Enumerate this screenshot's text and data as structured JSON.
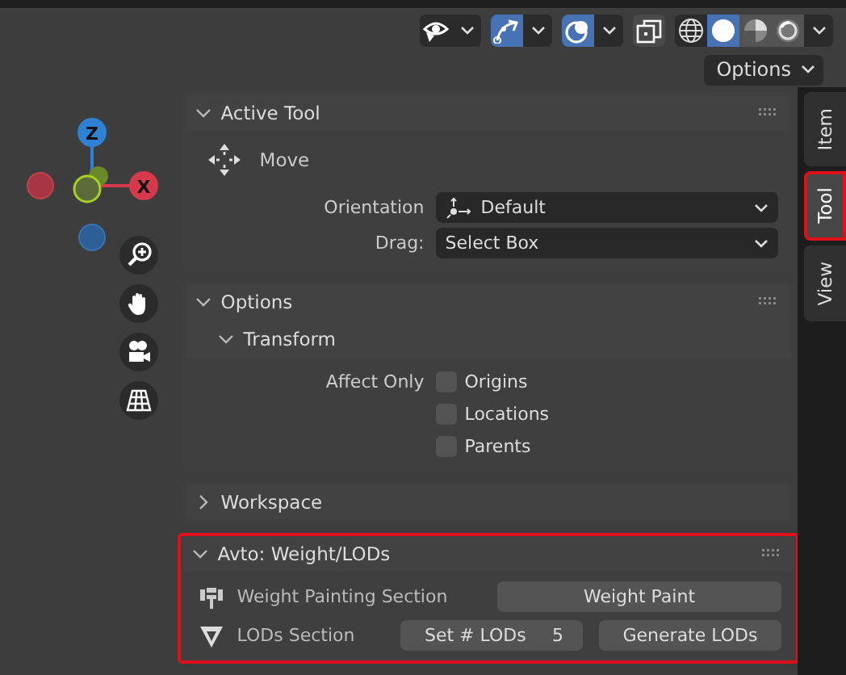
{
  "header": {
    "toggles": [
      {
        "kind": "visibility",
        "on": false
      },
      {
        "kind": "gizmo",
        "on": true
      },
      {
        "kind": "overlay",
        "on": true
      },
      {
        "kind": "xray",
        "on": false
      }
    ],
    "shading": [
      {
        "kind": "wireframe",
        "selected": false
      },
      {
        "kind": "solid",
        "selected": true
      },
      {
        "kind": "material",
        "selected": false
      },
      {
        "kind": "rendered",
        "selected": false
      }
    ]
  },
  "options_button": "Options",
  "gizmo_labels": [
    "Z",
    "X"
  ],
  "tabs": [
    {
      "label": "Item",
      "selected": false,
      "highlighted": false
    },
    {
      "label": "Tool",
      "selected": true,
      "highlighted": true
    },
    {
      "label": "View",
      "selected": false,
      "highlighted": false
    }
  ],
  "panels": [
    {
      "kind": "active_tool",
      "title": "Active Tool",
      "expanded": true,
      "highlighted": false,
      "tool": "Move",
      "fields": [
        {
          "label": "Orientation",
          "value": "Default",
          "kind": "orientation"
        },
        {
          "label": "Drag:",
          "value": "Select Box",
          "kind": "plain"
        }
      ]
    },
    {
      "kind": "options",
      "title": "Options",
      "expanded": true,
      "highlighted": false,
      "subpanel": {
        "title": "Transform",
        "expanded": true
      },
      "group_label": "Affect Only",
      "checkboxes": [
        {
          "label": "Origins",
          "checked": false
        },
        {
          "label": "Locations",
          "checked": false
        },
        {
          "label": "Parents",
          "checked": false
        }
      ]
    },
    {
      "title": "Workspace",
      "expanded": false,
      "highlighted": false
    },
    {
      "kind": "addon",
      "title": "Avto: Weight/LODs",
      "expanded": true,
      "highlighted": true,
      "rows": [
        {
          "kind": "weight",
          "label": "Weight Painting Section",
          "button": "Weight Paint"
        },
        {
          "kind": "lods",
          "label": "LODs Section",
          "number_label": "Set # LODs",
          "number_value": "5",
          "button": "Generate LODs"
        }
      ]
    }
  ]
}
